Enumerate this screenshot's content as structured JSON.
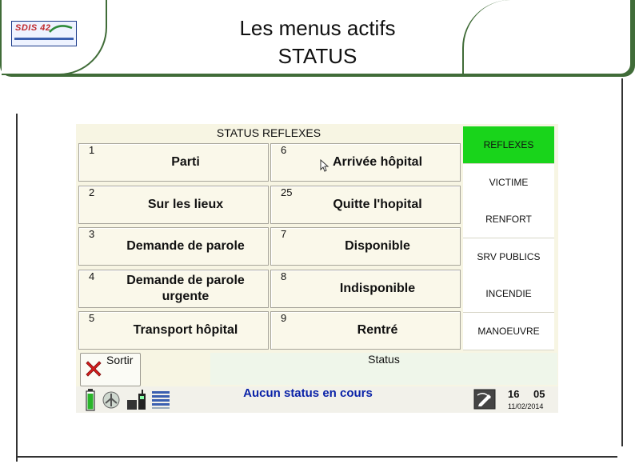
{
  "slide": {
    "title_line1": "Les menus actifs",
    "title_line2": "STATUS",
    "logo_text": "SDIS 42"
  },
  "grid": {
    "header": "STATUS REFLEXES",
    "buttons": [
      {
        "num": "1",
        "label": "Parti"
      },
      {
        "num": "6",
        "label": "Arrivée hôpital"
      },
      {
        "num": "2",
        "label": "Sur les lieux"
      },
      {
        "num": "25",
        "label": "Quitte l'hopital"
      },
      {
        "num": "3",
        "label": "Demande de parole"
      },
      {
        "num": "7",
        "label": "Disponible"
      },
      {
        "num": "4",
        "label": "Demande de parole urgente"
      },
      {
        "num": "8",
        "label": "Indisponible"
      },
      {
        "num": "5",
        "label": "Transport hôpital"
      },
      {
        "num": "9",
        "label": "Rentré"
      }
    ]
  },
  "sidebar": {
    "items": [
      {
        "label": "REFLEXES",
        "active": true
      },
      {
        "label": "VICTIME",
        "active": false
      },
      {
        "label": "RENFORT",
        "active": false
      },
      {
        "label": "SRV PUBLICS",
        "active": false
      },
      {
        "label": "INCENDIE",
        "active": false
      },
      {
        "label": "MANOEUVRE",
        "active": false
      }
    ]
  },
  "footer": {
    "sortir_label": "Sortir",
    "status_label": "Status",
    "current_status": "Aucun status en cours",
    "clock_hour": "16",
    "clock_minute": "05",
    "date": "11/02/2014"
  },
  "colors": {
    "header_green": "#406c38",
    "active_green": "#19d41b",
    "status_text_blue": "#0b23a8"
  },
  "icons": [
    "battery-icon",
    "antenna-icon",
    "radio-icon",
    "signal-bars-icon",
    "close-icon",
    "edit-icon",
    "cursor-icon"
  ]
}
